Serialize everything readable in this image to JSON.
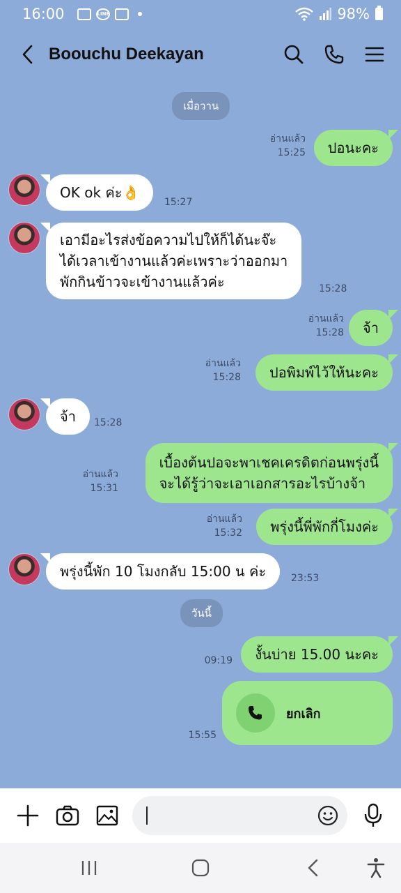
{
  "status_bar": {
    "time": "16:00",
    "battery": "98%",
    "line_badge": "LINE"
  },
  "header": {
    "contact_name": "Boouchu Deekayan"
  },
  "messages": {
    "date_yesterday": "เมื่อวาน",
    "m1": {
      "text": "ปอนะคะ",
      "read": "อ่านแล้ว",
      "time": "15:25"
    },
    "m2": {
      "text": "OK ok ค่ะ👌",
      "time": "15:27"
    },
    "m3": {
      "line1": "เอามีอะไรส่งข้อความไปให้ก็ได้นะจ๊ะ",
      "line2": "ได้เวลาเข้างานแล้วค่ะเพราะว่าออกมา",
      "line3": "พักกินข้าวจะเข้างานแล้วค่ะ",
      "time": "15:28"
    },
    "m4": {
      "text": "จ้า",
      "read": "อ่านแล้ว",
      "time": "15:28"
    },
    "m5": {
      "text": "ปอพิมพ์ไว้ให้นะคะ",
      "read": "อ่านแล้ว",
      "time": "15:28"
    },
    "m6": {
      "text": "จ้า",
      "time": "15:28"
    },
    "m7": {
      "line1": "เบื้องต้นปอจะพาเชคเครดิตก่อนพรุ่งนี้",
      "line2": "จะได้รู้ว่าจะเอาเอกสารอะไรบ้างจ้า",
      "read": "อ่านแล้ว",
      "time": "15:31"
    },
    "m8": {
      "text": "พรุ่งนี้พี่พักกี่โมงค่ะ",
      "read": "อ่านแล้ว",
      "time": "15:32"
    },
    "m9": {
      "text": "พรุ่งนี้พัก 10 โมงกลับ 15:00 น ค่ะ",
      "time": "23:53"
    },
    "date_today": "วันนี้",
    "m10": {
      "text": "งั้นบ่าย 15.00 นะคะ",
      "time": "09:19"
    },
    "call": {
      "label": "ยกเลิก",
      "time": "15:55"
    }
  },
  "input": {
    "placeholder": ""
  },
  "colors": {
    "chat_bg": "#8dabd8",
    "my_bubble": "#9de68e",
    "their_bubble": "#ffffff",
    "date_pill": "#7a93bb"
  }
}
